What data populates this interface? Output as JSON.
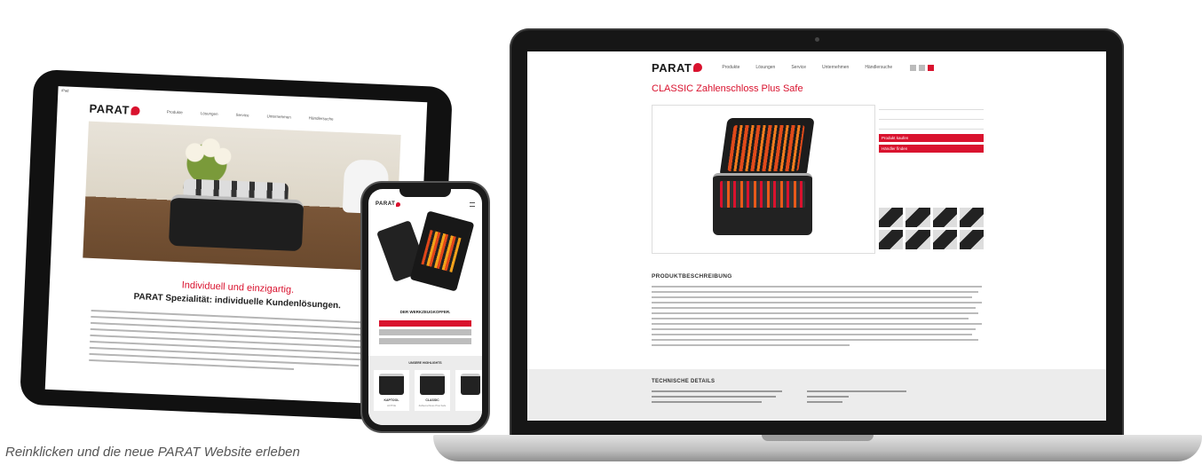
{
  "caption": "Reinklicken und die neue PARAT Website erleben",
  "colors": {
    "accent": "#d9122e",
    "text": "#333333",
    "device": "#161616"
  },
  "laptop": {
    "logo": "PARAT",
    "nav": [
      "Produkte",
      "Lösungen",
      "Service",
      "Unternehmen",
      "Händlersuche"
    ],
    "title": "CLASSIC Zahlenschloss Plus Safe",
    "buttons": [
      "Produkt kaufen",
      "Händler finden"
    ],
    "desc_title": "PRODUKTBESCHREIBUNG",
    "tech_title": "TECHNISCHE DETAILS"
  },
  "tablet": {
    "logo": "PARAT",
    "nav": [
      "Produkte",
      "Lösungen",
      "Service",
      "Unternehmen",
      "Händlersuche"
    ],
    "heading_red": "Individuell und einzigartig.",
    "heading": "PARAT Spezialität: individuelle Kundenlösungen."
  },
  "phone": {
    "logo": "PARAT",
    "subtitle": "DER WERKZEUGKOFFER.",
    "highlights_title": "UNSERE HIGHLIGHTS",
    "cards": [
      {
        "label": "KAPTOOL",
        "sub": "ACTIVE"
      },
      {
        "label": "CLASSIC",
        "sub": "Zahlenschloss Plus Safe"
      }
    ]
  }
}
